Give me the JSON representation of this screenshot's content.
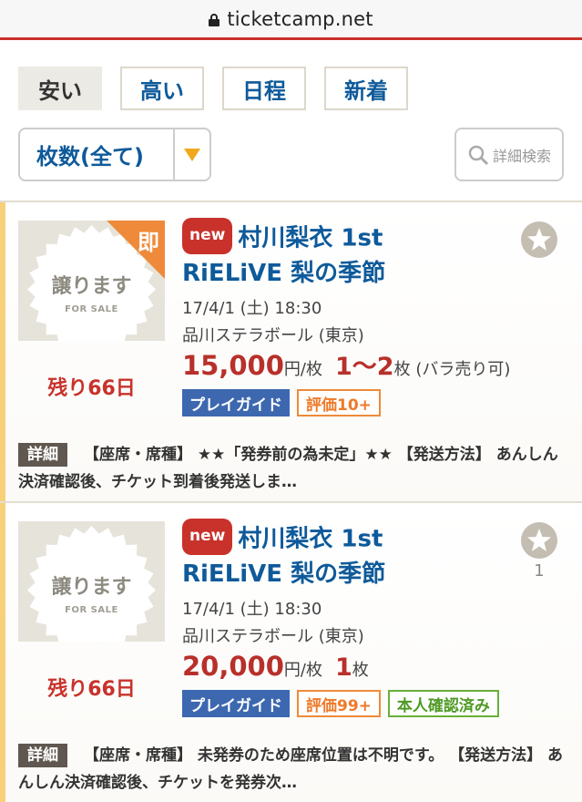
{
  "browser": {
    "url": "ticketcamp.net"
  },
  "sort_tabs": [
    {
      "label": "安い",
      "active": true
    },
    {
      "label": "高い",
      "active": false
    },
    {
      "label": "日程",
      "active": false
    },
    {
      "label": "新着",
      "active": false
    }
  ],
  "filter": {
    "count_label": "枚数(全て)",
    "search_label": "詳細検索"
  },
  "listings": [
    {
      "thumb_text": "譲ります",
      "thumb_sub": "FOR SALE",
      "corner_label": "即",
      "remaining": "残り66日",
      "new_label": "new",
      "title_line1": "村川梨衣 1st",
      "title_line2": "RiELiVE 梨の季節",
      "date": "17/4/1 (土) 18:30",
      "venue": "品川ステラボール (東京)",
      "price": "15,000",
      "price_unit": "円/枚",
      "qty": "1〜2",
      "qty_unit": "枚",
      "qty_note": "(バラ売り可)",
      "tags": [
        "プレイガイド",
        "評価10+"
      ],
      "fav_count": "",
      "detail_label": "詳細",
      "detail_text": "【座席・席種】 ★★「発券前の為未定」★★ 【発送方法】 あんしん決済確認後、チケット到着後発送しま…"
    },
    {
      "thumb_text": "譲ります",
      "thumb_sub": "FOR SALE",
      "corner_label": "",
      "remaining": "残り66日",
      "new_label": "new",
      "title_line1": "村川梨衣 1st",
      "title_line2": "RiELiVE 梨の季節",
      "date": "17/4/1 (土) 18:30",
      "venue": "品川ステラボール (東京)",
      "price": "20,000",
      "price_unit": "円/枚",
      "qty": "1",
      "qty_unit": "枚",
      "qty_note": "",
      "tags": [
        "プレイガイド",
        "評価99+",
        "本人確認済み"
      ],
      "fav_count": "1",
      "detail_label": "詳細",
      "detail_text": "【座席・席種】 未発券のため座席位置は不明です。 【発送方法】 あんしん決済確認後、チケットを発券次…"
    }
  ],
  "colors": {
    "brand_red": "#c8322b",
    "link_blue": "#0e5a9a",
    "accent_orange": "#f0a81c",
    "guide_blue": "#3d68b0"
  },
  "icons": [
    "lock-icon",
    "search-icon",
    "star-icon",
    "sunburst-badge",
    "dropdown-arrow-icon"
  ]
}
